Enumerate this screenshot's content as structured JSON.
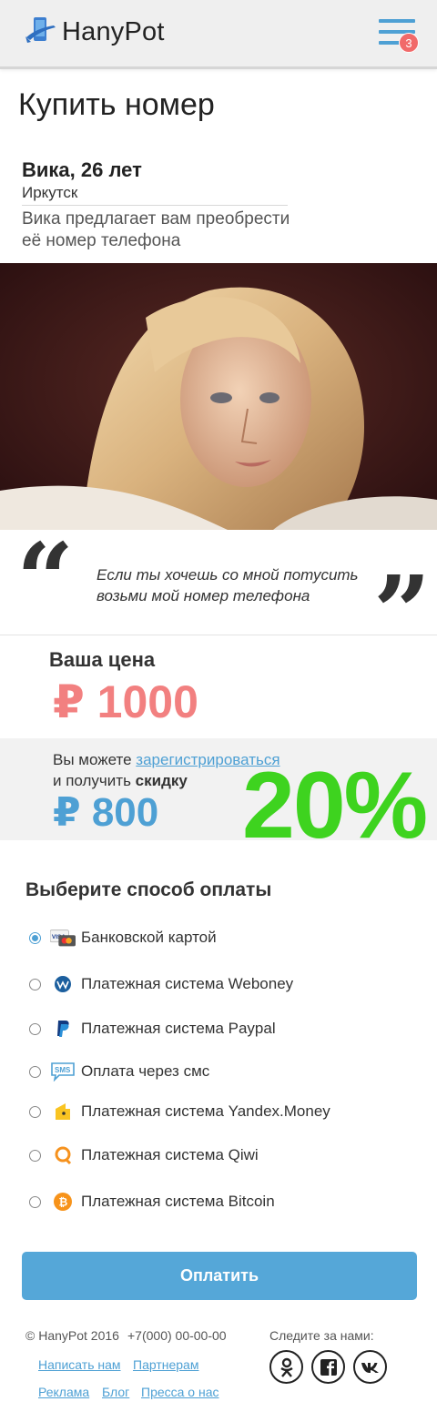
{
  "header": {
    "logo_text": "HanyPot",
    "menu_badge": "3"
  },
  "page": {
    "title": "Купить номер"
  },
  "profile": {
    "name": "Вика, 26 лет",
    "city": "Иркутск",
    "offer": "Вика предлагает вам преобрести её номер телефона"
  },
  "quote": {
    "open_mark": "“",
    "close_mark": "”",
    "text": "Если ты хочешь со мной потусить возьми мой номер телефона"
  },
  "price": {
    "label": "Ваша цена",
    "value": "₽ 1000"
  },
  "discount": {
    "line1_prefix": "Вы можете ",
    "register_link": "зарегистрироваться",
    "line2_prefix": "и получить ",
    "line2_bold": "скидку",
    "price": "₽ 800",
    "percent": "20%"
  },
  "payment": {
    "title": "Выберите способ оплаты",
    "options": [
      {
        "label": "Банковской картой",
        "icon": "visa-card-icon",
        "checked": true
      },
      {
        "label": "Платежная система Weboney",
        "icon": "webmoney-icon",
        "checked": false
      },
      {
        "label": "Платежная система Paypal",
        "icon": "paypal-icon",
        "checked": false
      },
      {
        "label": "Оплата через смс",
        "icon": "sms-icon",
        "checked": false
      },
      {
        "label": "Платежная система Yandex.Money",
        "icon": "yandex-money-icon",
        "checked": false
      },
      {
        "label": "Платежная система Qiwi",
        "icon": "qiwi-icon",
        "checked": false
      },
      {
        "label": "Платежная система Bitcoin",
        "icon": "bitcoin-icon",
        "checked": false
      }
    ],
    "button_label": "Оплатить"
  },
  "footer": {
    "copyright": "© HanyPot 2016",
    "phone": "+7(000) 00-00-00",
    "links": [
      "Написать нам",
      "Партнерам",
      "Реклама",
      "Блог",
      "Пресса о нас"
    ],
    "follow_label": "Следите за нами:",
    "social": [
      "odnoklassniki-icon",
      "facebook-icon",
      "vk-icon"
    ]
  },
  "colors": {
    "accent": "#4ea0d4",
    "price": "#f28080",
    "discount_percent": "#3ed31f",
    "badge": "#f16a6a"
  }
}
